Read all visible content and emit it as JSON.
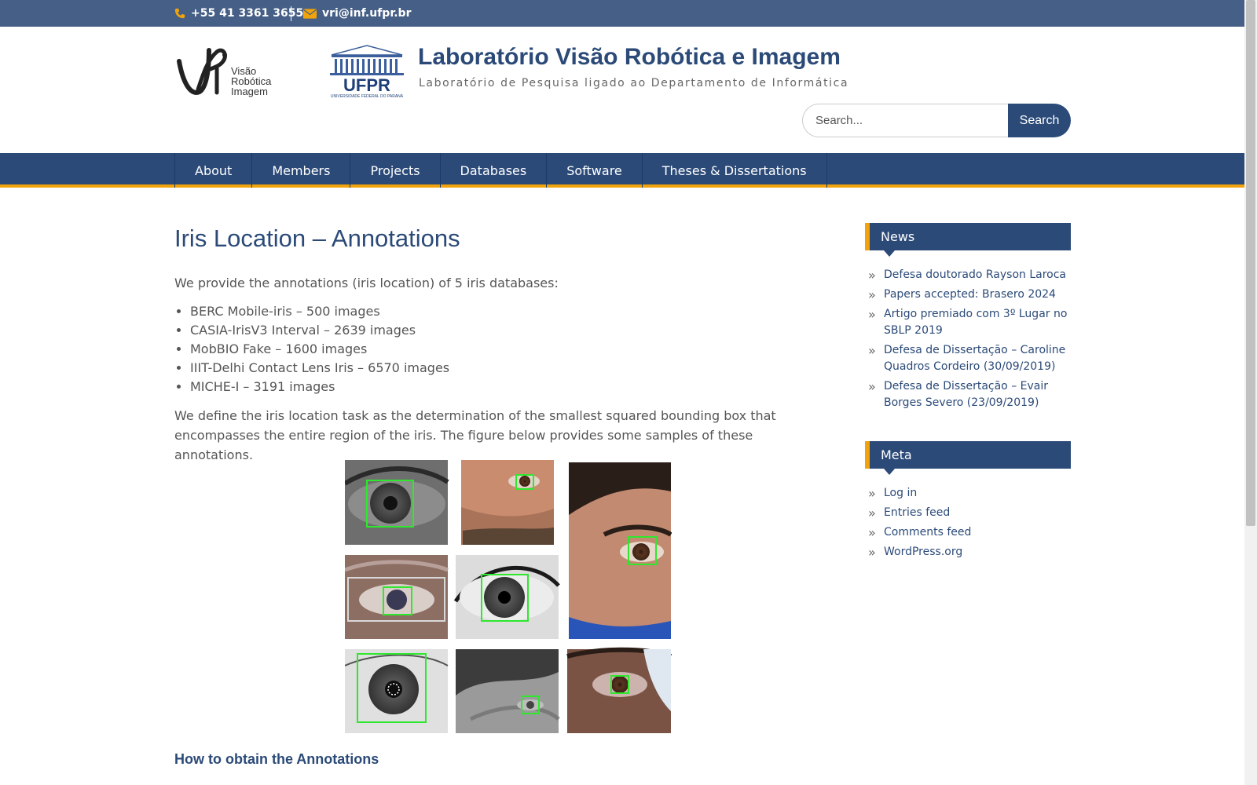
{
  "topbar": {
    "phone": "+55 41 3361 3655",
    "email": "vri@inf.ufpr.br"
  },
  "header": {
    "vri_logo_text": [
      "Visão",
      "Robótica",
      "Imagem"
    ],
    "ufpr_logo_text": "UFPR",
    "ufpr_logo_subtext": "UNIVERSIDADE FEDERAL DO PARANÁ",
    "title": "Laboratório Visão Robótica e Imagem",
    "description": "Laboratório de Pesquisa ligado ao Departamento de Informática"
  },
  "search": {
    "placeholder": "Search...",
    "button_label": "Search"
  },
  "nav": {
    "items": [
      "About",
      "Members",
      "Projects",
      "Databases",
      "Software",
      "Theses & Dissertations"
    ]
  },
  "main": {
    "title": "Iris Location – Annotations",
    "intro": "We provide the annotations (iris location) of 5 iris databases:",
    "databases": [
      "BERC Mobile-iris – 500 images",
      "CASIA-IrisV3 Interval – 2639 images",
      "MobBIO Fake – 1600 images",
      "IIIT-Delhi Contact Lens Iris – 6570 images",
      "MICHE-I – 3191 images"
    ],
    "definition": "We define the iris location task as the determination of the smallest squared bounding box that encompasses the entire region of the iris. The figure below provides some samples of these annotations.",
    "subheading": "How to obtain the Annotations"
  },
  "sidebar": {
    "news": {
      "title": "News",
      "items": [
        "Defesa doutorado Rayson Laroca",
        "Papers accepted: Brasero 2024",
        "Artigo premiado com 3º Lugar no SBLP 2019",
        "Defesa de Dissertação – Caroline Quadros Cordeiro (30/09/2019)",
        "Defesa de Dissertação – Evair Borges Severo (23/09/2019)"
      ]
    },
    "meta": {
      "title": "Meta",
      "items": [
        "Log in",
        "Entries feed",
        "Comments feed",
        "WordPress.org"
      ]
    }
  },
  "colors": {
    "topbar": "#465f86",
    "primary": "#2b4a78",
    "accent": "#f0a30a",
    "annotation_box": "#2ee82e"
  },
  "icons": [
    "phone-icon",
    "envelope-icon",
    "chevron-right-icon"
  ]
}
